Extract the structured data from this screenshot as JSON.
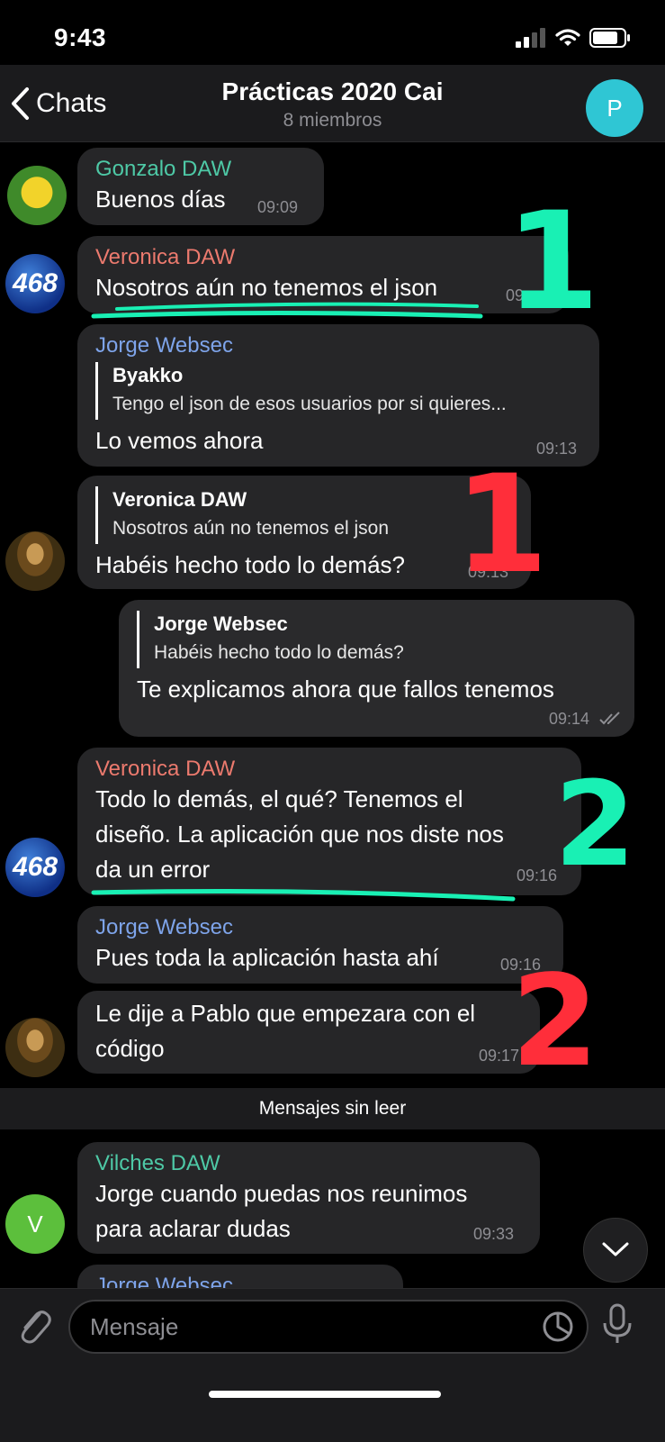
{
  "status_bar": {
    "time": "9:43"
  },
  "header": {
    "back_label": "Chats",
    "title": "Prácticas 2020 Cai",
    "subtitle": "8 miembros",
    "avatar_initial": "P"
  },
  "messages": [
    {
      "sender": "Gonzalo DAW",
      "sender_color": "#4ec9a6",
      "text": "Buenos días",
      "time": "09:09"
    },
    {
      "sender": "Veronica DAW",
      "sender_color": "#ec7a6e",
      "text": "Nosotros aún no tenemos el json",
      "time": "09"
    },
    {
      "sender": "Jorge Websec",
      "sender_color": "#7ea4ea",
      "reply_name": "Byakko",
      "reply_text": "Tengo el json de esos usuarios por si quieres...",
      "text": "Lo vemos ahora",
      "time": "09:13"
    },
    {
      "reply_name": "Veronica DAW",
      "reply_text": "Nosotros aún no tenemos el json",
      "text": "Habéis hecho todo lo demás?",
      "time": "09:13"
    },
    {
      "reply_name": "Jorge Websec",
      "reply_text": "Habéis hecho todo lo demás?",
      "text": "Te explicamos ahora que fallos tenemos",
      "time": "09:14"
    },
    {
      "sender": "Veronica DAW",
      "sender_color": "#ec7a6e",
      "lines": [
        "Todo lo demás, el qué? Tenemos el",
        "diseño. La aplicación que nos diste nos",
        "da un error"
      ],
      "time": "09:16"
    },
    {
      "sender": "Jorge Websec",
      "sender_color": "#7ea4ea",
      "text": "Pues toda la aplicación hasta ahí",
      "time": "09:16"
    },
    {
      "lines": [
        "Le dije a Pablo que empezara con el",
        "código"
      ],
      "time": "09:17"
    },
    {
      "sender": "Vilches DAW",
      "sender_color": "#4ec9a6",
      "lines": [
        "Jorge cuando puedas nos reunimos",
        "para aclarar dudas"
      ],
      "time": "09:33",
      "avatar_initial": "V"
    },
    {
      "sender": "Jorge Websec",
      "sender_color": "#7ea4ea"
    }
  ],
  "avatars": {
    "veronica_text": "468"
  },
  "unread_label": "Mensajes sin leer",
  "input": {
    "placeholder": "Mensaje"
  },
  "annotations": {
    "green_mark_1": "1",
    "red_mark_1": "1",
    "green_mark_2": "2",
    "red_mark_2": "2"
  },
  "colors": {
    "background": "#000000",
    "bubble": "#262628",
    "accent": "#2fc6d4",
    "green_pen": "#19f0b4",
    "red_pen": "#ff2e3a"
  }
}
